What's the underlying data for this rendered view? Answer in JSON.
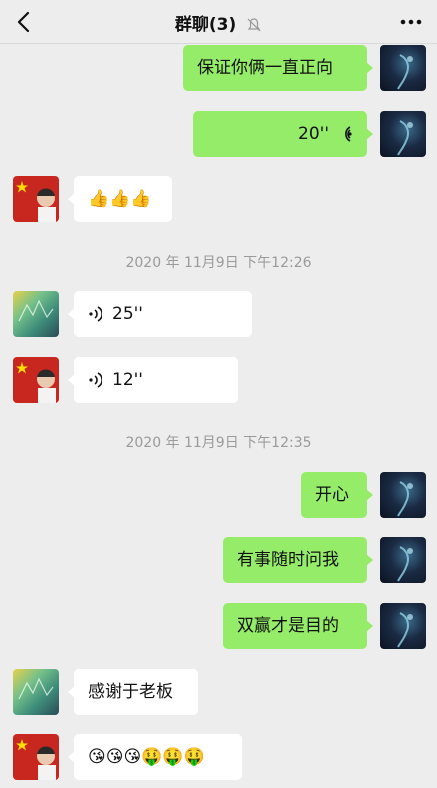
{
  "header": {
    "title": "群聊(3)",
    "back_icon": "chevron-left-icon",
    "mute_icon": "bell-muted-icon",
    "more_icon": "more-dots-icon"
  },
  "timestamps": [
    "2020 年 11月9日  下午12:26",
    "2020 年 11月9日  下午12:35"
  ],
  "messages": {
    "m1": {
      "text": "保证你俩一直正向"
    },
    "m2": {
      "duration": "20''"
    },
    "m3": {
      "emoji": "👍👍👍"
    },
    "m4": {
      "duration": "25''"
    },
    "m5": {
      "duration": "12''"
    },
    "m6": {
      "text": "开心"
    },
    "m7": {
      "text": "有事随时问我"
    },
    "m8": {
      "text": "双赢才是目的"
    },
    "m9": {
      "text": "感谢于老板"
    },
    "m10": {
      "emoji": "😘😘😘🤑🤑🤑"
    }
  },
  "colors": {
    "background": "#ededed",
    "self_bubble": "#95ec69",
    "other_bubble": "#ffffff",
    "timestamp": "#9a9a9a"
  }
}
